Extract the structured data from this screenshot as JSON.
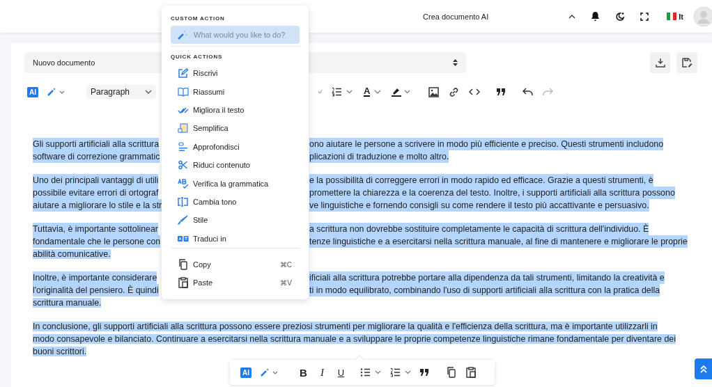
{
  "top_bar": {
    "document_menu": "Crea documento AI",
    "language": "It"
  },
  "editor": {
    "document_select": "Nuovo documento",
    "toolbar": {
      "ai_badge": "AI",
      "block_style": "Paragraph",
      "text_color_glyph": "A",
      "redo_disabled": true
    },
    "paragraphs": [
      {
        "selected": true,
        "lines": [
          {
            "left": "Gli supporti artificiali alla scrittura",
            "right": "ono aiutare le persone a scrivere in modo più efficiente e preciso. Questi strumenti includono"
          },
          {
            "left": "software di correzione grammatic",
            "right": "plicazioni di traduzione e molto altro."
          }
        ]
      },
      {
        "selected": true,
        "lines": [
          {
            "left": "Uno dei principali vantaggi di utili",
            "right": "e la possibilità di correggere errori in modo rapido ed efficace. Grazie a questi strumenti, è"
          },
          {
            "left": "possibile evitare errori di ortograf",
            "right": "promettere la chiarezza e la coerenza del testo. Inoltre, i supporti artificiali alla scrittura possono"
          },
          {
            "left": "aiutare a migliorare lo stile e la str",
            "right": "ve linguistiche e fornendo consigli su come rendere il testo più accattivante e persuasivo."
          }
        ]
      },
      {
        "selected": true,
        "lines": [
          {
            "left": "Tuttavia, è importante sottolinear",
            "right": "a scrittura non dovrebbe sostituire completamente le capacità di scrittura dell'individuo. È"
          },
          {
            "left": "fondamentale che le persone con",
            "right": "tenze linguistiche e a esercitarsi nella scrittura manuale, al fine di mantenere e migliorare le proprie"
          },
          {
            "left": "abilità comunicative."
          }
        ]
      },
      {
        "selected": true,
        "lines": [
          {
            "left": "Inoltre, è importante considerare",
            "right": "ificiali alla scrittura potrebbe portare alla dipendenza da tali strumenti, limitando la creatività e"
          },
          {
            "left": "l'originalità del pensiero. È quindi",
            "right": "ti in modo equilibrato, combinando l'uso di supporti artificiali alla scrittura con la pratica della"
          },
          {
            "left": "scrittura manuale."
          }
        ]
      },
      {
        "selected": true,
        "lines": [
          {
            "left": "In conclusione, gli supporti artificiali alla scrittura possono essere preziosi strumenti per migliorare la qualità e l'efficienza della scrittura, ma è importante utilizzarli in"
          },
          {
            "left": "modo consapevole e bilanciato. Continuare a esercitarsi nella scrittura manuale e a sviluppare le proprie competenze linguistiche rimane fondamentale per diventare dei"
          },
          {
            "left": "buoni scrittori."
          }
        ]
      }
    ]
  },
  "context_menu": {
    "custom_heading": "CUSTOM ACTION",
    "placeholder": "What would you like to do?",
    "quick_heading": "QUICK ACTIONS",
    "quick_actions": [
      {
        "kind": "rewrite",
        "label": "Riscrivi"
      },
      {
        "kind": "summarize",
        "label": "Riassumi"
      },
      {
        "kind": "improve",
        "label": "Migliora il testo"
      },
      {
        "kind": "simplify",
        "label": "Semplifica"
      },
      {
        "kind": "expand",
        "label": "Approfondisci"
      },
      {
        "kind": "shorten",
        "label": "Riduci contenuto"
      },
      {
        "kind": "grammar",
        "label": "Verifica la grammatica"
      },
      {
        "kind": "tone",
        "label": "Cambia tono"
      },
      {
        "kind": "style",
        "label": "Stile"
      },
      {
        "kind": "translate",
        "label": "Traduci in"
      }
    ],
    "clipboard": [
      {
        "kind": "copy",
        "label": "Copy",
        "shortcut": "⌘C"
      },
      {
        "kind": "paste",
        "label": "Paste",
        "shortcut": "⌘V"
      }
    ]
  },
  "floating_toolbar": {
    "ai_badge": "AI",
    "format_buttons": [
      "B",
      "I",
      "U"
    ]
  }
}
